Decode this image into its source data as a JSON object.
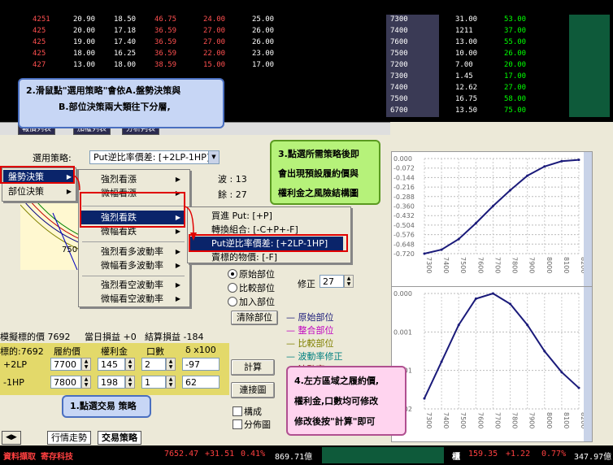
{
  "quote_rows": [
    [
      "4251",
      "20.90",
      "18.50",
      "46.75",
      "24.00",
      "25.00",
      "7300",
      "31.00",
      "53.00"
    ],
    [
      "425",
      "20.00",
      "17.18",
      "36.59",
      "27.00",
      "26.00",
      "7400",
      "1211",
      "37.00"
    ],
    [
      "425",
      "19.00",
      "17.40",
      "36.59",
      "27.00",
      "26.00",
      "7600",
      "13.00",
      "55.00"
    ],
    [
      "425",
      "18.00",
      "16.25",
      "36.59",
      "22.00",
      "23.00",
      "7500",
      "10.00",
      "26.00"
    ],
    [
      "427",
      "13.00",
      "18.00",
      "38.59",
      "15.00",
      "17.00",
      "7200",
      "7.00",
      "20.00"
    ],
    [
      "",
      "",
      "",
      "",
      "",
      "",
      "7300",
      "1.45",
      "17.00"
    ],
    [
      "",
      "",
      "",
      "",
      "",
      "",
      "7400",
      "12.62",
      "27.00"
    ],
    [
      "",
      "",
      "",
      "",
      "",
      "",
      "7500",
      "16.75",
      "58.00"
    ],
    [
      "",
      "",
      "",
      "",
      "",
      "",
      "6700",
      "13.50",
      "75.00"
    ]
  ],
  "top_tabs": [
    "報價列表",
    "加權列表",
    "分析判表"
  ],
  "strategy_select": {
    "prefix": "選用策略:",
    "value": "Put逆比率價差: [+2LP-1HP]"
  },
  "menu_level1": [
    "盤勢決策",
    "部位決策"
  ],
  "menu_level2": [
    "強烈看漲",
    "微幅看漲",
    "強烈看跌",
    "微幅看跌",
    "強烈看多波動率",
    "微幅看多波動率",
    "強烈看空波動率",
    "微幅看空波動率"
  ],
  "menu_level3": [
    "買進 Put: [+P]",
    "轉換組合: [-C+P+-F]",
    "Put逆比率價差: [+2LP-1HP]",
    "賣標的物價: [-F]"
  ],
  "side_info": {
    "wave_label": "波 : 13",
    "remain_label": "餘 : 27"
  },
  "mini_chart_tick": "7500",
  "radio_options": [
    "原始部位",
    "比較部位",
    "加入部位"
  ],
  "clear_button": "清除部位",
  "correction": {
    "label": "修正",
    "value": "27"
  },
  "legend": [
    {
      "text": "原始部位",
      "color": "#1a1a7a"
    },
    {
      "text": "整合部位",
      "color": "#c000c0"
    },
    {
      "text": "比較部位",
      "color": "#808000"
    },
    {
      "text": "波動率修正",
      "color": "#008080"
    },
    {
      "text": "波動率",
      "color": "#800000"
    }
  ],
  "sim_row": {
    "a": "模擬標的價 7692",
    "b": "當日損益 +0",
    "c": "結算損益 -184"
  },
  "table_header": [
    "標的:7692",
    "履約價",
    "權利金",
    "口數",
    "δ x100"
  ],
  "legs": [
    {
      "name": "+2LP",
      "strike": "7700",
      "premium": "145",
      "qty": "2",
      "delta": "-97"
    },
    {
      "name": "-1HP",
      "strike": "7800",
      "premium": "198",
      "qty": "1",
      "delta": "62"
    }
  ],
  "calc_button": "計算",
  "connect_button": "連接圖",
  "checkboxes": [
    "構成",
    "分佈圖"
  ],
  "bottom_tabs": [
    "行情走勢",
    "交易策略"
  ],
  "chart1_yticks": [
    "0.000",
    "-0.072",
    "-0.144",
    "-0.216",
    "-0.288",
    "-0.360",
    "-0.432",
    "-0.504",
    "-0.576",
    "-0.648",
    "-0.720"
  ],
  "chart2_yticks": [
    "0.000",
    "0.001",
    "0.001",
    "0.002"
  ],
  "chart_xticks": [
    "7300",
    "7400",
    "7500",
    "7600",
    "7700",
    "7800",
    "7900",
    "8000",
    "8100",
    "8200"
  ],
  "callouts": {
    "c1": "1.點選交易 策略",
    "c2a": "2.滑鼠點\"選用策略\"會依A.盤勢決策與",
    "c2b": "B.部位決策兩大類往下分層,",
    "c3a": "3.點選所需策略後即",
    "c3b": "會出現預設履約價與",
    "c3c": "權利金之風險結構圖",
    "c4a": "4.左方區域之履約價,",
    "c4b": "權利金,口數均可修改",
    "c4c": "修改後按\"計算\"即可"
  },
  "ticker": {
    "t1": "資料擷取 寄存科技",
    "t2": "7652.47",
    "t3": "+31.51",
    "t4": "0.41%",
    "t5": "869.71億",
    "t6": "櫃",
    "t7": "159.35",
    "t8": "+1.22",
    "t9": "0.77%",
    "t10": "347.97億"
  },
  "chart_data": [
    {
      "type": "line",
      "x": [
        7300,
        7400,
        7500,
        7600,
        7700,
        7800,
        7900,
        8000,
        8100,
        8200
      ],
      "values": [
        -0.72,
        -0.69,
        -0.61,
        -0.49,
        -0.36,
        -0.24,
        -0.13,
        -0.06,
        -0.02,
        -0.01
      ],
      "ylim": [
        -0.72,
        0.0
      ]
    },
    {
      "type": "line",
      "x": [
        7300,
        7400,
        7500,
        7600,
        7700,
        7800,
        7900,
        8000,
        8100,
        8200
      ],
      "values": [
        0.0002,
        0.0009,
        0.0016,
        0.0021,
        0.0022,
        0.002,
        0.0016,
        0.0011,
        0.0007,
        0.0004
      ],
      "ylim": [
        0,
        0.0022
      ]
    }
  ],
  "colors": {
    "menu_highlight": "#0a246a",
    "callout_blue": "#c7d6f5",
    "callout_yellow": "#fff7a8",
    "callout_green": "#b6f27a",
    "callout_pink": "#ffd4ef",
    "red_box": "#e00000",
    "curve": "#1a1a7a"
  }
}
